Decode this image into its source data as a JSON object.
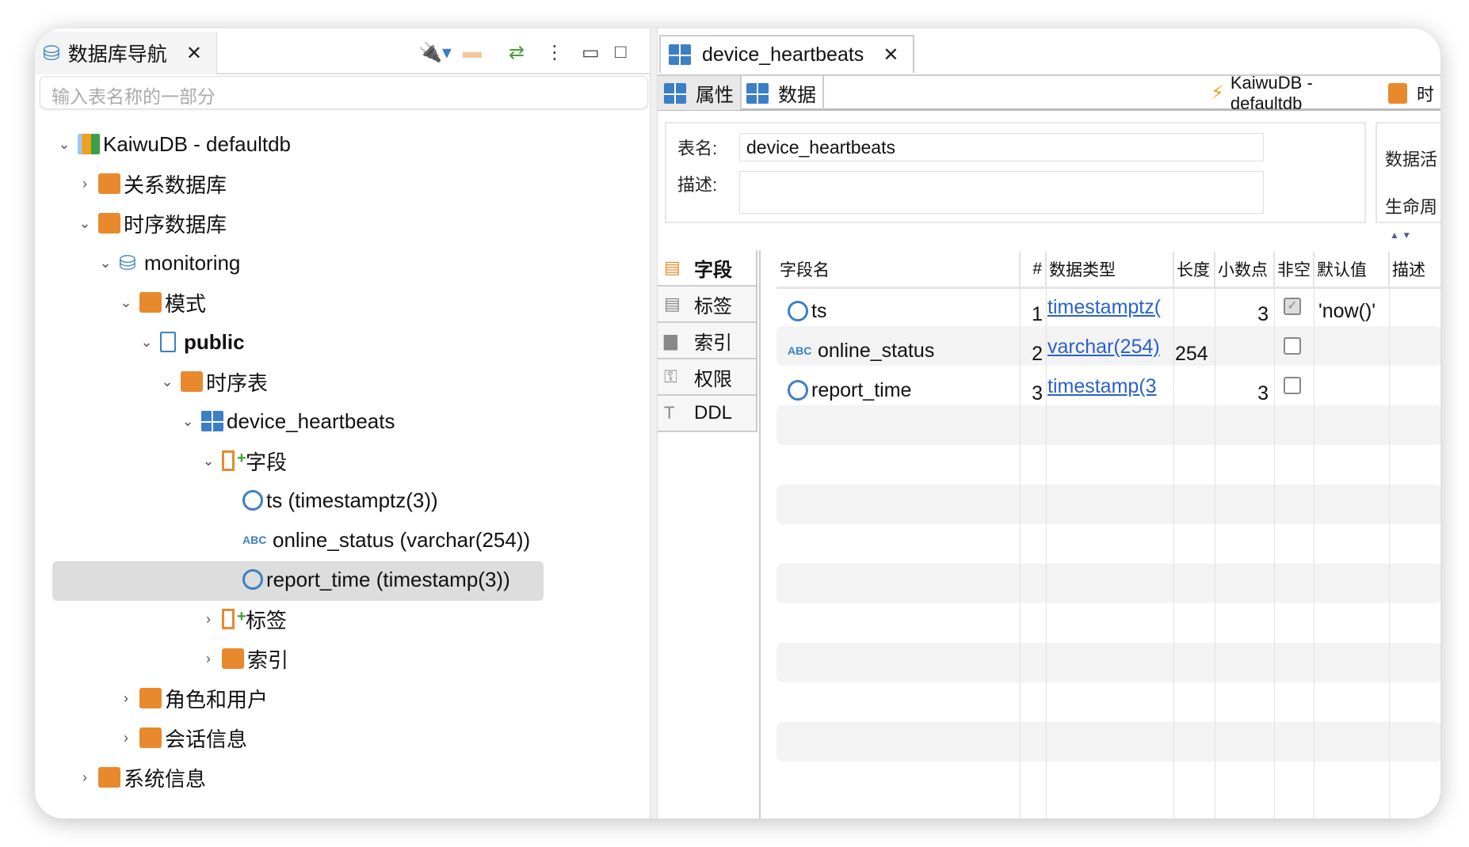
{
  "navigator": {
    "title": "数据库导航",
    "search_placeholder": "输入表名称的一部分"
  },
  "tree": [
    {
      "label": "KaiwuDB - defaultdb",
      "level": 0,
      "state": "open",
      "icon": "kaiwudb-icon"
    },
    {
      "label": "关系数据库",
      "level": 1,
      "state": "closed",
      "icon": "database-folder-icon"
    },
    {
      "label": "时序数据库",
      "level": 1,
      "state": "open",
      "icon": "database-folder-icon"
    },
    {
      "label": "monitoring",
      "level": 2,
      "state": "open",
      "icon": "database-icon"
    },
    {
      "label": "模式",
      "level": 3,
      "state": "open",
      "icon": "folder-icon"
    },
    {
      "label": "public",
      "level": 4,
      "state": "open",
      "icon": "schema-icon"
    },
    {
      "label": "时序表",
      "level": 5,
      "state": "open",
      "icon": "folder-icon"
    },
    {
      "label": "device_heartbeats",
      "level": 6,
      "state": "open",
      "icon": "table-icon"
    },
    {
      "label": "字段",
      "level": 7,
      "state": "open",
      "icon": "columns-icon"
    },
    {
      "label": "ts (timestamptz(3))",
      "level": 8,
      "state": "leaf",
      "icon": "clock-icon"
    },
    {
      "label": "online_status (varchar(254))",
      "level": 8,
      "state": "leaf",
      "icon": "abc-icon"
    },
    {
      "label": "report_time (timestamp(3))",
      "level": 8,
      "state": "leaf",
      "icon": "clock-icon",
      "selected": true
    },
    {
      "label": "标签",
      "level": 7,
      "state": "closed",
      "icon": "columns-icon"
    },
    {
      "label": "索引",
      "level": 7,
      "state": "closed",
      "icon": "folder-icon"
    },
    {
      "label": "角色和用户",
      "level": 3,
      "state": "closed",
      "icon": "folder-icon"
    },
    {
      "label": "会话信息",
      "level": 3,
      "state": "closed",
      "icon": "folder-icon"
    },
    {
      "label": "系统信息",
      "level": 1,
      "state": "closed",
      "icon": "folder-icon"
    }
  ],
  "editor": {
    "tab_title": "device_heartbeats",
    "subtabs": [
      "属性",
      "数据"
    ],
    "connection": "KaiwuDB - defaultdb",
    "connection_extra": "时",
    "table_name_label": "表名:",
    "table_name": "device_heartbeats",
    "desc_label": "描述:",
    "desc": "",
    "side_labels": [
      "数据活",
      "生命周"
    ],
    "vtabs": [
      "字段",
      "标签",
      "索引",
      "权限",
      "DDL"
    ],
    "columns": [
      "字段名",
      "#",
      "数据类型",
      "长度",
      "小数点",
      "非空",
      "默认值",
      "描述"
    ],
    "rows": [
      {
        "name": "ts",
        "icon": "clock-icon",
        "num": "1",
        "type": "timestamptz(",
        "length": "",
        "scale": "3",
        "notnull": true,
        "default": "'now()'",
        "desc": ""
      },
      {
        "name": "online_status",
        "icon": "abc-icon",
        "num": "2",
        "type": "varchar(254)",
        "length": "254",
        "scale": "",
        "notnull": false,
        "default": "",
        "desc": ""
      },
      {
        "name": "report_time",
        "icon": "clock-icon",
        "num": "3",
        "type": "timestamp(3",
        "length": "",
        "scale": "3",
        "notnull": false,
        "default": "",
        "desc": ""
      }
    ]
  },
  "colors": {
    "accent": "#3c7fc7",
    "folder": "#e8892e",
    "link": "#2a62c9",
    "selected": "#dddddd"
  }
}
